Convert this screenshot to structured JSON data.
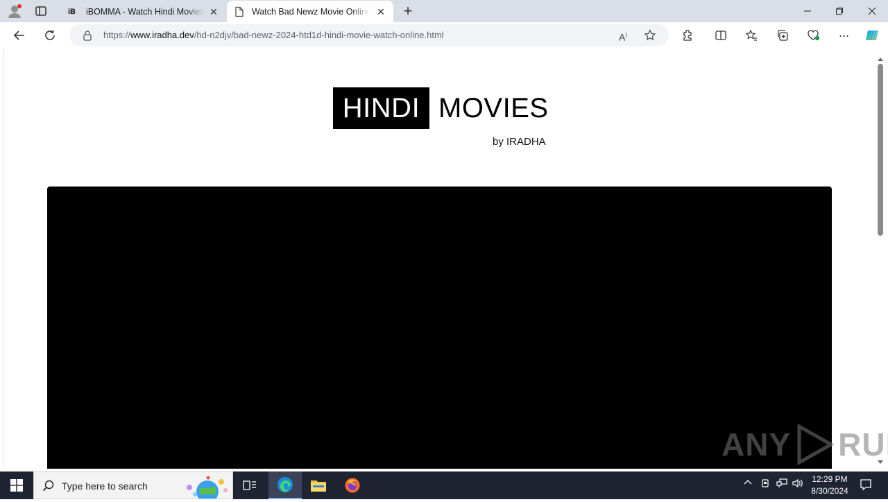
{
  "browser": {
    "tabs": [
      {
        "title": "iBOMMA - Watch Hindi Movies Online",
        "favicon": "iB",
        "active": false
      },
      {
        "title": "Watch Bad Newz Movie Online in HD",
        "favicon": "page-icon",
        "active": true
      }
    ],
    "new_tab_label": "+",
    "url_prefix": "https://",
    "url_host": "www.iradha.dev",
    "url_path": "/hd-n2djv/bad-newz-2024-htd1d-hindi-movie-watch-online.html"
  },
  "page": {
    "logo_left": "HINDI",
    "logo_right": "MOVIES",
    "logo_byline": "by IRADHA"
  },
  "watermark": {
    "text_left": "ANY",
    "text_right": "RUN"
  },
  "taskbar": {
    "search_placeholder": "Type here to search",
    "time": "12:29 PM",
    "date": "8/30/2024"
  }
}
